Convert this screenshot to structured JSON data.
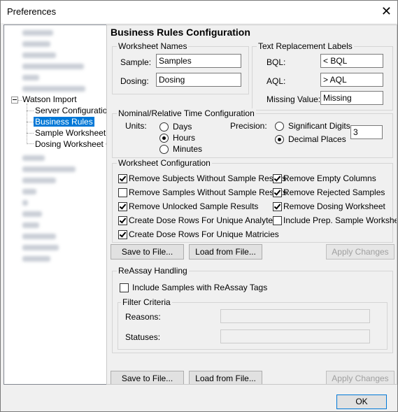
{
  "window": {
    "title": "Preferences"
  },
  "tree": {
    "watson_import": "Watson Import",
    "children": [
      "Server Configuration",
      "Business Rules",
      "Sample Worksheet C",
      "Dosing Worksheet C"
    ]
  },
  "heading": "Business Rules Configuration",
  "worksheet_names": {
    "title": "Worksheet Names",
    "sample_label": "Sample:",
    "sample_value": "Samples",
    "dosing_label": "Dosing:",
    "dosing_value": "Dosing"
  },
  "text_replacement": {
    "title": "Text Replacement Labels",
    "bql_label": "BQL:",
    "bql_value": "< BQL",
    "aql_label": "AQL:",
    "aql_value": "> AQL",
    "missing_label": "Missing Value:",
    "missing_value": "Missing"
  },
  "time_config": {
    "title": "Nominal/Relative Time Configuration",
    "units_label": "Units:",
    "units": [
      {
        "label": "Days",
        "selected": false
      },
      {
        "label": "Hours",
        "selected": true
      },
      {
        "label": "Minutes",
        "selected": false
      }
    ],
    "precision_label": "Precision:",
    "precision": [
      {
        "label": "Significant Digits",
        "selected": false
      },
      {
        "label": "Decimal Places",
        "selected": true
      }
    ],
    "precision_value": "3"
  },
  "worksheet_config": {
    "title": "Worksheet Configuration",
    "left": [
      {
        "label": "Remove Subjects Without Sample Results",
        "checked": true
      },
      {
        "label": "Remove Samples Without Sample Results",
        "checked": false
      },
      {
        "label": "Remove Unlocked Sample Results",
        "checked": true
      },
      {
        "label": "Create Dose Rows For Unique Analytes",
        "checked": true
      },
      {
        "label": "Create Dose Rows For Unique Matricies",
        "checked": true
      }
    ],
    "right": [
      {
        "label": "Remove Empty Columns",
        "checked": true
      },
      {
        "label": "Remove Rejected Samples",
        "checked": true
      },
      {
        "label": "Remove Dosing Worksheet",
        "checked": true
      },
      {
        "label": "Include Prep. Sample Worksheet",
        "checked": false
      }
    ]
  },
  "buttons": {
    "save": "Save to File...",
    "load": "Load from File...",
    "apply": "Apply Changes",
    "ok": "OK"
  },
  "reassay": {
    "title": "ReAssay Handling",
    "include_label": "Include Samples with ReAssay Tags",
    "include_checked": false,
    "filter_title": "Filter Criteria",
    "reasons_label": "Reasons:",
    "statuses_label": "Statuses:"
  }
}
